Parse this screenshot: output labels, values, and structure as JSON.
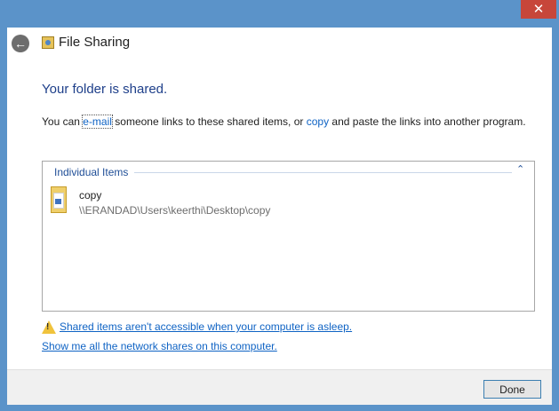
{
  "window": {
    "title": "File Sharing",
    "back_glyph": "←",
    "close_glyph": "✕",
    "app_icon": "file-sharing-icon"
  },
  "main": {
    "heading": "Your folder is shared.",
    "desc_prefix": "You can ",
    "email_link": "e-mail",
    "desc_middle": " someone links to these shared items, or ",
    "copy_link": "copy",
    "desc_suffix": " and paste the links into another program."
  },
  "items_group": {
    "header": "Individual Items",
    "collapse_glyph": "⌃",
    "items": [
      {
        "name": "copy",
        "path": "\\\\ERANDAD\\Users\\keerthi\\Desktop\\copy"
      }
    ]
  },
  "warning": {
    "icon": "warning-icon",
    "mark": "!",
    "text": "Shared items aren't accessible when your computer is asleep."
  },
  "shares_link": "Show me all the network shares on this computer.",
  "footer": {
    "done_label": "Done"
  }
}
